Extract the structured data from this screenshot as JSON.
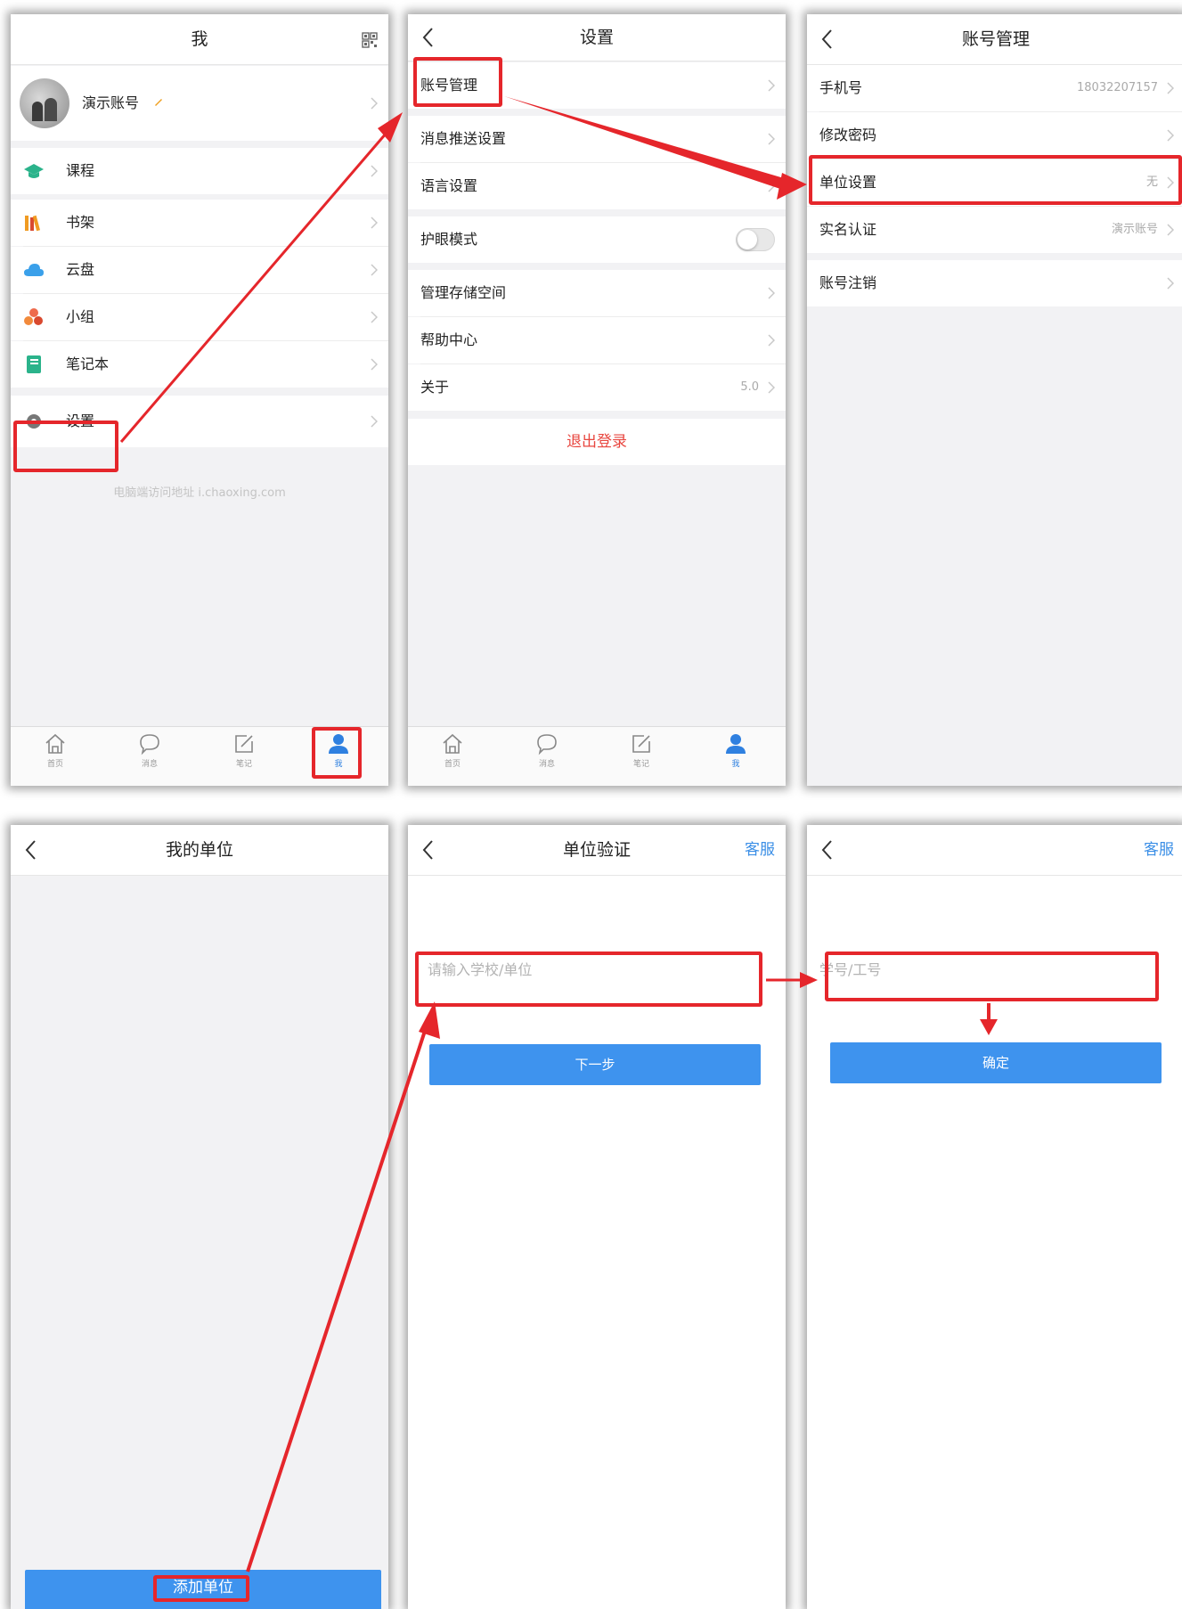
{
  "screen_me": {
    "title": "我",
    "qr_icon": "qr-code-icon",
    "profile_name": "演示账号",
    "menu": [
      {
        "label": "课程",
        "icon": "course-cap-icon",
        "color": "#2bb38b"
      },
      {
        "label": "书架",
        "icon": "bookshelf-icon",
        "color": "#f09b22"
      },
      {
        "label": "云盘",
        "icon": "cloud-icon",
        "color": "#3aa0ea"
      },
      {
        "label": "小组",
        "icon": "group-icon",
        "color": "#ee6b4d"
      },
      {
        "label": "笔记本",
        "icon": "notebook-icon",
        "color": "#2bb38b"
      }
    ],
    "settings_label": "设置",
    "footer_note": "电脑端访问地址 i.chaoxing.com"
  },
  "tabs": [
    {
      "label": "首页",
      "icon": "home-icon"
    },
    {
      "label": "消息",
      "icon": "message-icon"
    },
    {
      "label": "笔记",
      "icon": "note-icon"
    },
    {
      "label": "我",
      "icon": "person-icon"
    }
  ],
  "screen_settings": {
    "title": "设置",
    "account_mgmt": "账号管理",
    "push_settings": "消息推送设置",
    "language": "语言设置",
    "eye_mode": "护眼模式",
    "storage": "管理存储空间",
    "help": "帮助中心",
    "about": "关于",
    "version": "5.0",
    "logout": "退出登录"
  },
  "screen_account": {
    "title": "账号管理",
    "phone_label": "手机号",
    "phone_value": "18032207157",
    "password_label": "修改密码",
    "unit_label": "单位设置",
    "unit_value": "无",
    "realname_label": "实名认证",
    "realname_value": "演示账号",
    "cancel_label": "账号注销"
  },
  "screen_myunit": {
    "title": "我的单位",
    "add_button": "添加单位"
  },
  "screen_verify": {
    "title": "单位验证",
    "service": "客服",
    "placeholder": "请输入学校/单位",
    "next_button": "下一步"
  },
  "screen_studentid": {
    "service": "客服",
    "placeholder": "学号/工号",
    "confirm_button": "确定"
  },
  "colors": {
    "accent_blue": "#3e93ee",
    "highlight_red": "#e5262b",
    "logout_red": "#e8463f"
  }
}
